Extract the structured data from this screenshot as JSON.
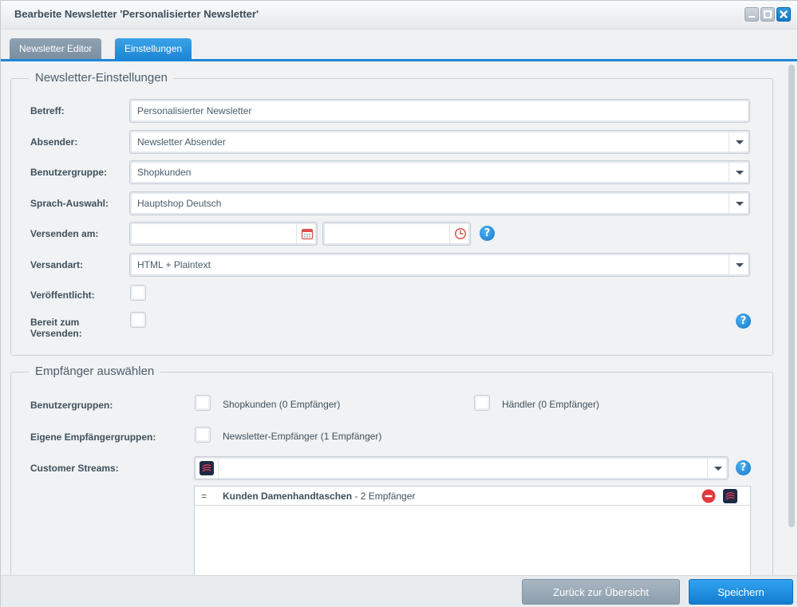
{
  "window": {
    "title": "Bearbeite Newsletter 'Personalisierter Newsletter'"
  },
  "tabs": [
    {
      "label": "Newsletter Editor",
      "active": false
    },
    {
      "label": "Einstellungen",
      "active": true
    }
  ],
  "settings": {
    "legend": "Newsletter-Einstellungen",
    "betreff": {
      "label": "Betreff:",
      "value": "Personalisierter Newsletter"
    },
    "absender": {
      "label": "Absender:",
      "value": "Newsletter Absender"
    },
    "benutzergruppe": {
      "label": "Benutzergruppe:",
      "value": "Shopkunden"
    },
    "sprache": {
      "label": "Sprach-Auswahl:",
      "value": "Hauptshop Deutsch"
    },
    "versenden_am": {
      "label": "Versenden am:",
      "date_value": "",
      "time_value": ""
    },
    "versandart": {
      "label": "Versandart:",
      "value": "HTML + Plaintext"
    },
    "veroeffentlicht": {
      "label": "Veröffentlicht:",
      "checked": false
    },
    "bereit": {
      "label_line1": "Bereit zum",
      "label_line2": "Versenden:",
      "checked": false
    }
  },
  "recipients": {
    "legend": "Empfänger auswählen",
    "benutzergruppen": {
      "label": "Benutzergruppen:",
      "options": [
        {
          "label": "Shopkunden (0 Empfänger)",
          "checked": false
        },
        {
          "label": "Händler (0 Empfänger)",
          "checked": false
        }
      ]
    },
    "eigene": {
      "label": "Eigene Empfängergruppen:",
      "options": [
        {
          "label": "Newsletter-Empfänger (1 Empfänger)",
          "checked": false
        }
      ]
    },
    "streams": {
      "label": "Customer Streams:",
      "value": "",
      "items": [
        {
          "handle": "=",
          "name": "Kunden Damenhandtaschen",
          "suffix": " - 2 Empfänger"
        }
      ]
    }
  },
  "footer": {
    "back_label": "Zurück zur Übersicht",
    "save_label": "Speichern"
  },
  "colors": {
    "accent": "#1d87d6",
    "tab_inactive": "#7a8fa1",
    "delete": "#e0393e"
  }
}
